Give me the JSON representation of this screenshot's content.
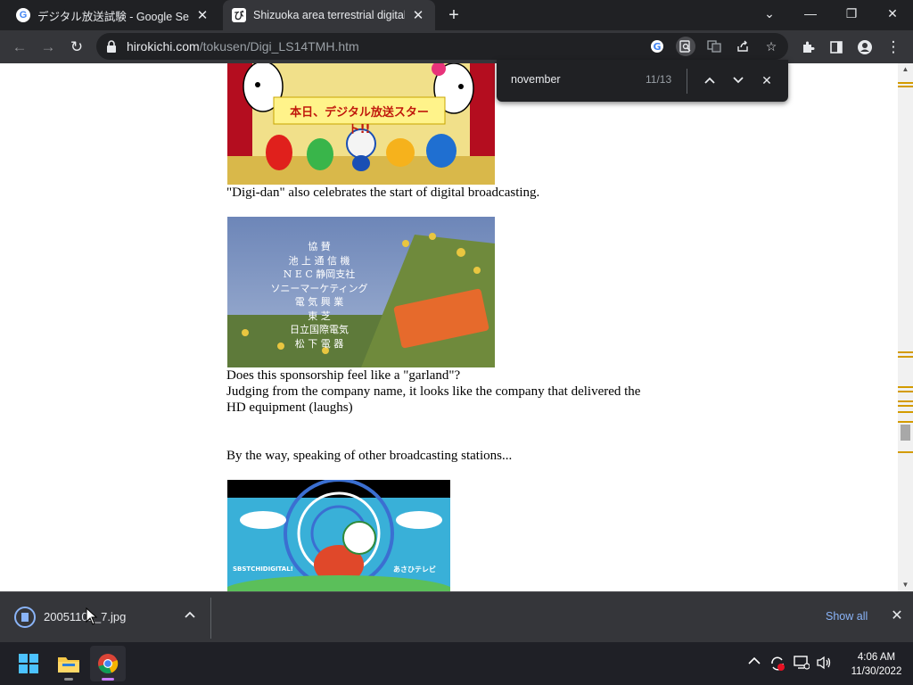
{
  "tabs": [
    {
      "title": "デジタル放送試験 - Google Search",
      "active": false
    },
    {
      "title": "Shizuoka area terrestrial digital &",
      "active": true
    }
  ],
  "toolbar": {
    "url_host": "hirokichi.com",
    "url_path": "/tokusen/Digi_LS14TMH.htm"
  },
  "find": {
    "query": "november",
    "count": "11/13"
  },
  "content": {
    "caption1": "\"Digi-dan\" also celebrates the start of digital broadcasting.",
    "banner_text": "本日、デジタル放送スタート!!",
    "sponsor_title": "協 賛",
    "sponsors": [
      "池 上 通 信 機",
      "N E C 静岡支社",
      "ソニーマーケティング",
      "電 気 興 業",
      "東    芝",
      "日立国際電気",
      "松 下 電 器"
    ],
    "para2_line1": "Does this sponsorship feel like a \"garland\"?",
    "para2_line2": "Judging from the company name, it looks like the company that delivered the",
    "para2_line3": "HD equipment (laughs)",
    "para3": "By the way, speaking of other broadcasting stations...",
    "img3_left_label": "SBSTCHIDIGITAL!",
    "img3_right_label": "あさひテレビ"
  },
  "downloads": {
    "file_name": "20051101_7.jpg",
    "show_all": "Show all"
  },
  "taskbar": {
    "time": "4:06 AM",
    "date": "11/30/2022"
  },
  "colors": {
    "tab_strip": "#202124",
    "toolbar": "#35363a",
    "find_highlight": "#d39b00",
    "link_blue": "#8ab4f8"
  }
}
